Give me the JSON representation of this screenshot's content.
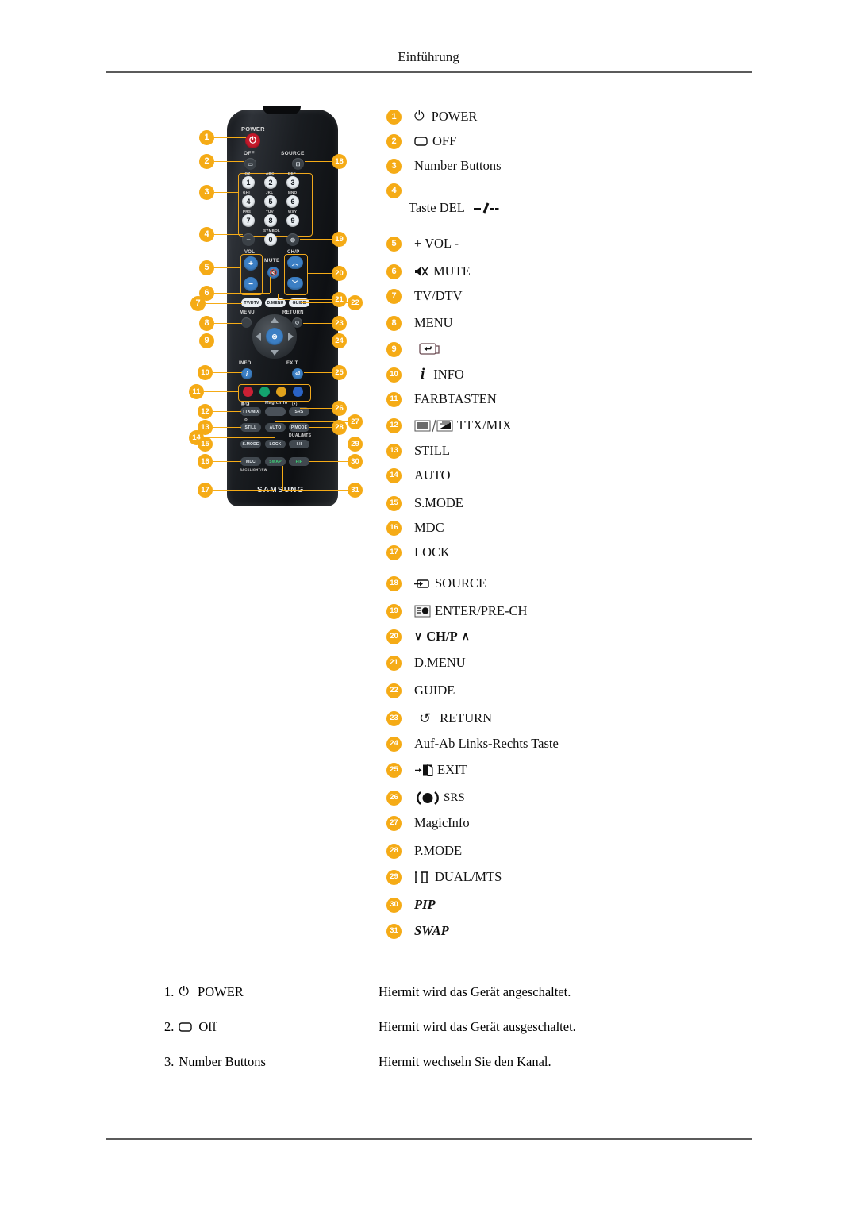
{
  "page": {
    "header_title": "Einführung"
  },
  "remote": {
    "brand": "SAMSUNG",
    "labels": {
      "power": "POWER",
      "off": "OFF",
      "source": "SOURCE",
      "vol": "VOL",
      "mute": "MUTE",
      "chp": "CH/P",
      "menu": "MENU",
      "return": "RETURN",
      "info": "INFO",
      "exit": "EXIT",
      "tvdtv": "TV/DTV",
      "dmenu": "D.MENU",
      "guide": "GUIDE",
      "magicinfo": "MagicInfo",
      "srs": "SRS",
      "ttxmix": "TTX/MIX",
      "still": "STILL",
      "auto": "AUTO",
      "pmode": "P.MODE",
      "smode": "S.MODE",
      "lock": "LOCK",
      "dualmts": "DUAL/MTS",
      "dualmts_key": "I-II",
      "mdc": "MDC",
      "mdc_sub": "BACKLIGHT/SW",
      "swap": "SWAP",
      "pip": "PIP"
    },
    "keypad": [
      {
        "digit": "1",
        "sub": ".QZ"
      },
      {
        "digit": "2",
        "sub": "ABC"
      },
      {
        "digit": "3",
        "sub": "DEF"
      },
      {
        "digit": "4",
        "sub": "GHI"
      },
      {
        "digit": "5",
        "sub": "JKL"
      },
      {
        "digit": "6",
        "sub": "MNO"
      },
      {
        "digit": "7",
        "sub": "PRS"
      },
      {
        "digit": "8",
        "sub": "TUV"
      },
      {
        "digit": "9",
        "sub": "WXY"
      },
      {
        "digit": "0",
        "sub": "SYMBOL"
      }
    ],
    "color_keys": [
      "#cc2034",
      "#13a46e",
      "#e0a21c",
      "#2a63c6"
    ],
    "callouts": [
      "1",
      "2",
      "3",
      "4",
      "5",
      "6",
      "7",
      "8",
      "9",
      "10",
      "11",
      "12",
      "13",
      "14",
      "15",
      "16",
      "17",
      "18",
      "19",
      "20",
      "21",
      "22",
      "23",
      "24",
      "25",
      "26",
      "27",
      "28",
      "29",
      "30",
      "31"
    ]
  },
  "legend": {
    "items": [
      {
        "n": "1",
        "icon": "power-icon",
        "label": "POWER"
      },
      {
        "n": "2",
        "icon": "off-rounded-rect-icon",
        "label": "OFF"
      },
      {
        "n": "3",
        "icon": "",
        "label": "Number Buttons"
      },
      {
        "n": "4",
        "icon": "del-dash-icon",
        "label": "Taste DEL"
      },
      {
        "n": "5",
        "icon": "",
        "label": "+ VOL -"
      },
      {
        "n": "6",
        "icon": "mute-speaker-icon",
        "label": "MUTE"
      },
      {
        "n": "7",
        "icon": "",
        "label": "TV/DTV"
      },
      {
        "n": "8",
        "icon": "",
        "label": "MENU"
      },
      {
        "n": "9",
        "icon": "enter-return-icon",
        "label": ""
      },
      {
        "n": "10",
        "icon": "info-i-icon",
        "label": "INFO"
      },
      {
        "n": "11",
        "icon": "",
        "label": "FARBTASTEN"
      },
      {
        "n": "12",
        "icon": "ttx-mix-icon",
        "label": "TTX/MIX"
      },
      {
        "n": "13",
        "icon": "",
        "label": "STILL"
      },
      {
        "n": "14",
        "icon": "",
        "label": "AUTO"
      },
      {
        "n": "15",
        "icon": "",
        "label": "S.MODE"
      },
      {
        "n": "16",
        "icon": "",
        "label": "MDC"
      },
      {
        "n": "17",
        "icon": "",
        "label": "LOCK"
      },
      {
        "n": "18",
        "icon": "source-arrow-icon",
        "label": "SOURCE"
      },
      {
        "n": "19",
        "icon": "enter-prech-icon",
        "label": "ENTER/PRE-CH"
      },
      {
        "n": "20",
        "icon": "chevron-down-up-icon",
        "label": "CH/P"
      },
      {
        "n": "21",
        "icon": "",
        "label": "D.MENU"
      },
      {
        "n": "22",
        "icon": "",
        "label": "GUIDE"
      },
      {
        "n": "23",
        "icon": "return-arrow-icon",
        "label": "RETURN"
      },
      {
        "n": "24",
        "icon": "",
        "label": "Auf-Ab Links-Rechts Taste"
      },
      {
        "n": "25",
        "icon": "exit-door-icon",
        "label": "EXIT"
      },
      {
        "n": "26",
        "icon": "srs-icon",
        "label": "SRS"
      },
      {
        "n": "27",
        "icon": "",
        "label": "MagicInfo"
      },
      {
        "n": "28",
        "icon": "",
        "label": "P.MODE"
      },
      {
        "n": "29",
        "icon": "dual-mts-icon",
        "label": "DUAL/MTS"
      },
      {
        "n": "30",
        "icon": "",
        "label": "PIP",
        "italic": true
      },
      {
        "n": "31",
        "icon": "",
        "label": "SWAP",
        "italic": true
      }
    ]
  },
  "descriptions": [
    {
      "num": "1.",
      "icon": "power-icon",
      "term": "POWER",
      "text": "Hiermit wird das Gerät angeschaltet."
    },
    {
      "num": "2.",
      "icon": "off-rounded-rect-icon",
      "term": "Off",
      "text": "Hiermit wird das Gerät ausgeschaltet."
    },
    {
      "num": "3.",
      "icon": "",
      "term": "Number Buttons",
      "text": "Hiermit wechseln Sie den Kanal."
    }
  ]
}
